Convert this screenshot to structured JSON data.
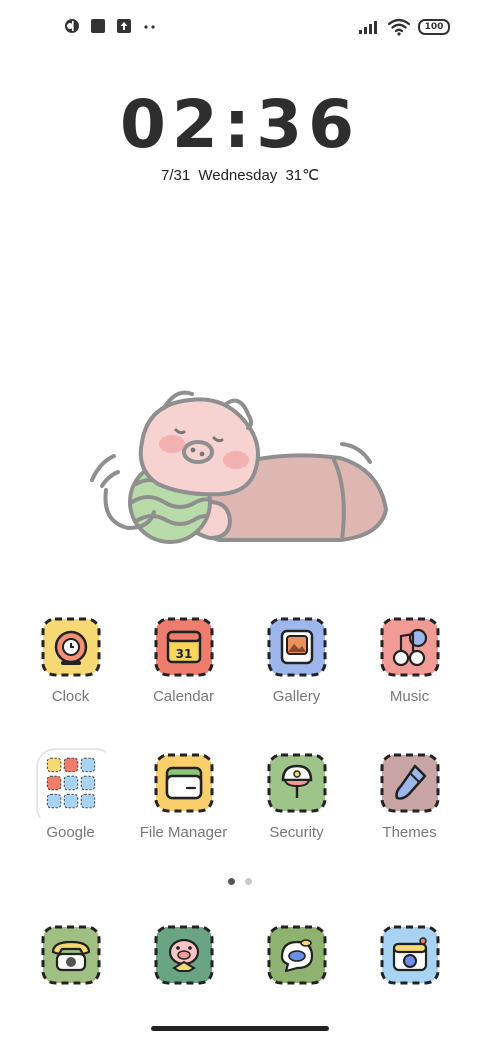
{
  "status": {
    "battery": "100",
    "left_icons": [
      "app-icon-round",
      "app-icon-square",
      "upload-icon",
      "more-dots-icon"
    ],
    "right_icons": [
      "signal-icon",
      "wifi-icon",
      "battery-icon"
    ]
  },
  "lockclock": {
    "time": "02:36",
    "date": "7/31  Wednesday   31℃"
  },
  "widget": {
    "image": "sleeping-pig-illustration"
  },
  "apps": [
    {
      "label": "Clock",
      "icon": "clock-icon",
      "color": "#f6d874"
    },
    {
      "label": "Calendar",
      "icon": "calendar-icon",
      "color": "#ee7d6d"
    },
    {
      "label": "Gallery",
      "icon": "gallery-icon",
      "color": "#9db7ec"
    },
    {
      "label": "Music",
      "icon": "music-icon",
      "color": "#f29b96"
    },
    {
      "label": "Google",
      "icon": "google-folder-icon",
      "color": "#ffffff"
    },
    {
      "label": "File Manager",
      "icon": "folder-icon",
      "color": "#f8cf6a"
    },
    {
      "label": "Security",
      "icon": "security-icon",
      "color": "#9fc48a"
    },
    {
      "label": "Themes",
      "icon": "themes-icon",
      "color": "#c9a4a4"
    }
  ],
  "calendar_day": "31",
  "pager": {
    "pages": 2,
    "current": 1
  },
  "dock": [
    {
      "icon": "phone-icon",
      "color": "#9fbf83"
    },
    {
      "icon": "pig-contacts-icon",
      "color": "#6aa583"
    },
    {
      "icon": "messages-icon",
      "color": "#8fb270"
    },
    {
      "icon": "camera-icon",
      "color": "#a9d3f2"
    }
  ]
}
